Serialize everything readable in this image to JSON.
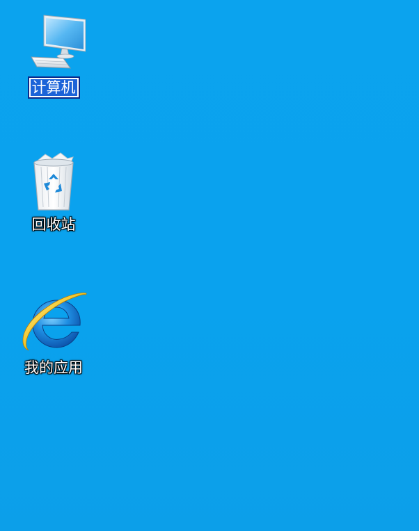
{
  "desktop": {
    "background_color": "#0AA2EE",
    "icons": [
      {
        "label": "计算机",
        "icon": "computer-icon",
        "selected": true
      },
      {
        "label": "回收站",
        "icon": "recycle-bin-icon",
        "selected": false
      },
      {
        "label": "我的应用",
        "icon": "ie-browser-icon",
        "selected": false
      }
    ]
  }
}
